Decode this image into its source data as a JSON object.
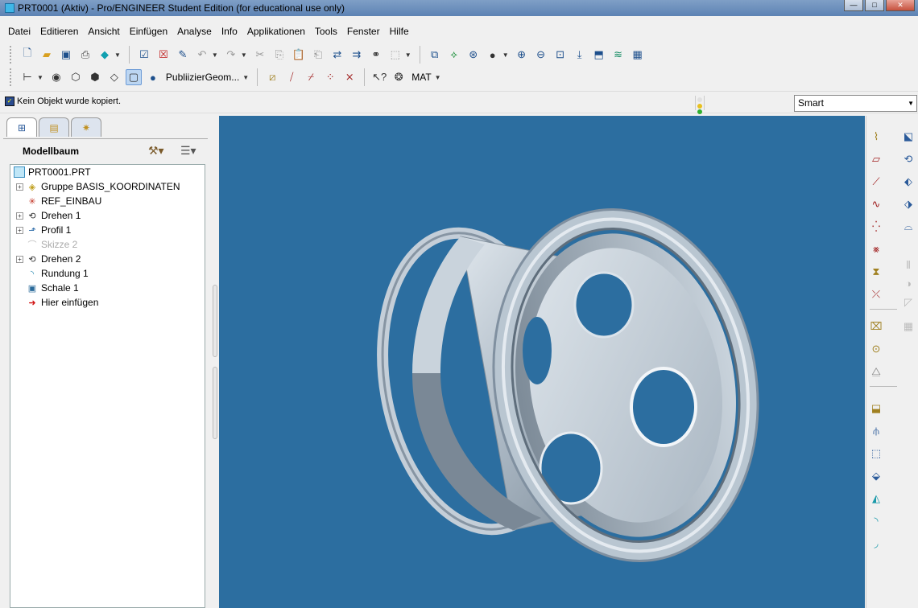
{
  "window": {
    "title": "PRT0001 (Aktiv) - Pro/ENGINEER Student Edition (for educational use only)"
  },
  "menu": [
    "Datei",
    "Editieren",
    "Ansicht",
    "Einfügen",
    "Analyse",
    "Info",
    "Applikationen",
    "Tools",
    "Fenster",
    "Hilfe"
  ],
  "toolbar": {
    "publish_label": "PubliizierGeom...",
    "material_label": "MAT"
  },
  "status": {
    "message": "Kein Objekt wurde kopiert.",
    "filter_value": "Smart"
  },
  "model_tree": {
    "title": "Modellbaum",
    "items": [
      {
        "label": "PRT0001.PRT",
        "icon": "part-icon"
      },
      {
        "label": "Gruppe BASIS_KOORDINATEN",
        "icon": "group-icon"
      },
      {
        "label": "REF_EINBAU",
        "icon": "reference-icon"
      },
      {
        "label": "Drehen 1",
        "icon": "revolve-icon"
      },
      {
        "label": "Profil 1",
        "icon": "profile-icon"
      },
      {
        "label": "Skizze 2",
        "icon": "sketch-icon"
      },
      {
        "label": "Drehen 2",
        "icon": "revolve-icon"
      },
      {
        "label": "Rundung 1",
        "icon": "round-icon"
      },
      {
        "label": "Schale 1",
        "icon": "shell-icon"
      },
      {
        "label": "Hier einfügen",
        "icon": "insert-here-arrow-icon"
      }
    ]
  },
  "colors": {
    "viewport_bg": "#2c6ea0",
    "model": "#b9c6d1",
    "insert_arrow": "#d01010"
  }
}
